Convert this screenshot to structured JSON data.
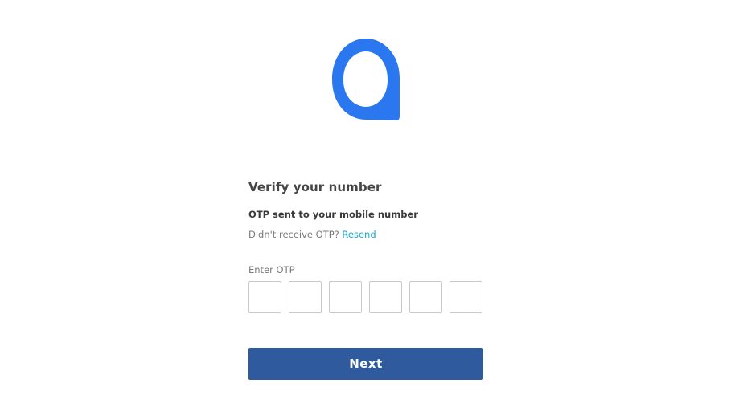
{
  "brand": {
    "logo_icon": "app-logo-icon",
    "logo_color": "#2a77f0"
  },
  "verify": {
    "title": "Verify your number",
    "subtitle": "OTP sent to your mobile number",
    "resend_prompt": "Didn't receive OTP?",
    "resend_link": "Resend",
    "resend_link_color": "#1fa6c9"
  },
  "otp": {
    "label": "Enter OTP",
    "digits": [
      "",
      "",
      "",
      "",
      "",
      ""
    ]
  },
  "actions": {
    "next_label": "Next",
    "next_color": "#2f5a9e"
  }
}
